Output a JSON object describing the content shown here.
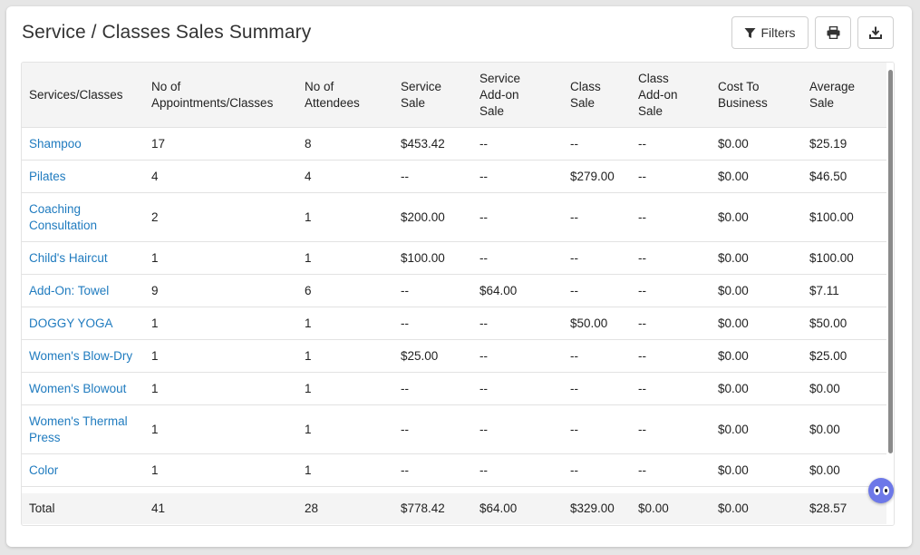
{
  "page": {
    "title": "Service / Classes Sales Summary"
  },
  "toolbar": {
    "filters_label": "Filters",
    "filters_icon": "filter-icon",
    "print_icon": "print-icon",
    "download_icon": "download-icon"
  },
  "table": {
    "headers": [
      "Services/Classes",
      "No of Appointments/Classes",
      "No of Attendees",
      "Service Sale",
      "Service Add-on Sale",
      "Class Sale",
      "Class Add-on Sale",
      "Cost To Business",
      "Average Sale"
    ],
    "rows": [
      [
        "Shampoo",
        "17",
        "8",
        "$453.42",
        "--",
        "--",
        "--",
        "$0.00",
        "$25.19"
      ],
      [
        "Pilates",
        "4",
        "4",
        "--",
        "--",
        "$279.00",
        "--",
        "$0.00",
        "$46.50"
      ],
      [
        "Coaching Consultation",
        "2",
        "1",
        "$200.00",
        "--",
        "--",
        "--",
        "$0.00",
        "$100.00"
      ],
      [
        "Child's Haircut",
        "1",
        "1",
        "$100.00",
        "--",
        "--",
        "--",
        "$0.00",
        "$100.00"
      ],
      [
        "Add-On: Towel",
        "9",
        "6",
        "--",
        "$64.00",
        "--",
        "--",
        "$0.00",
        "$7.11"
      ],
      [
        "DOGGY YOGA",
        "1",
        "1",
        "--",
        "--",
        "$50.00",
        "--",
        "$0.00",
        "$50.00"
      ],
      [
        "Women's Blow-Dry",
        "1",
        "1",
        "$25.00",
        "--",
        "--",
        "--",
        "$0.00",
        "$25.00"
      ],
      [
        "Women's Blowout",
        "1",
        "1",
        "--",
        "--",
        "--",
        "--",
        "$0.00",
        "$0.00"
      ],
      [
        "Women's Thermal Press",
        "1",
        "1",
        "--",
        "--",
        "--",
        "--",
        "$0.00",
        "$0.00"
      ],
      [
        "Color",
        "1",
        "1",
        "--",
        "--",
        "--",
        "--",
        "$0.00",
        "$0.00"
      ]
    ],
    "total": [
      "Total",
      "41",
      "28",
      "$778.42",
      "$64.00",
      "$329.00",
      "$0.00",
      "$0.00",
      "$28.57"
    ]
  },
  "colors": {
    "link": "#1f7bbf",
    "header_bg": "#f4f4f4",
    "chat_bot": "#6d78e8"
  },
  "chat_widget_icon": "chat-bot-icon"
}
